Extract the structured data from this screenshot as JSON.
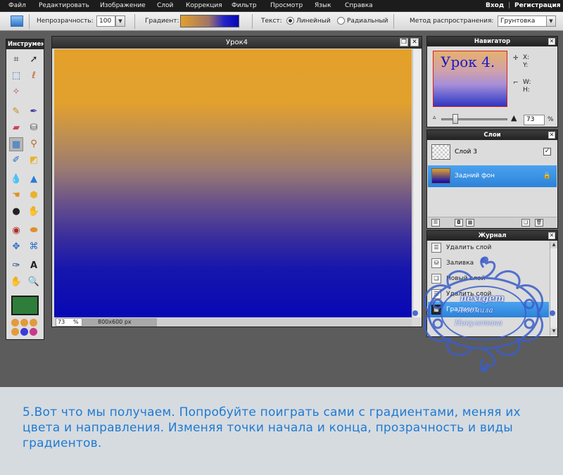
{
  "menubar": {
    "items": [
      "Файл",
      "Редактировать",
      "Изображение",
      "Слой",
      "Коррекция",
      "Фильтр",
      "Просмотр",
      "Язык",
      "Справка"
    ],
    "login": "Вход",
    "register": "Регистрация"
  },
  "options": {
    "opacity_label": "Непрозрачность:",
    "opacity_value": "100",
    "gradient_label": "Градиент:",
    "text_label": "Текст:",
    "radio_linear": "Линейный",
    "radio_radial": "Радиальный",
    "spread_label": "Метод распространения:",
    "spread_value": "Грунтовка"
  },
  "tools": {
    "title": "Инструменты",
    "icons": [
      "crop-icon",
      "move-icon",
      "marquee-icon",
      "lasso-icon",
      "wand-icon",
      "pencil-icon",
      "brush-icon",
      "eraser-icon",
      "bucket-icon",
      "gradient-icon",
      "stamp-icon",
      "replace-color-icon",
      "drawing-icon",
      "blur-icon",
      "sharpen-icon",
      "smudge-icon",
      "sponge-icon",
      "dodge-icon",
      "burn-icon",
      "redeye-icon",
      "spot-heal-icon",
      "bloat-icon",
      "pinch-icon",
      "color-picker-icon",
      "text-icon",
      "hand-icon",
      "zoom-icon"
    ],
    "color_active": "#2f7d3a"
  },
  "document": {
    "title": "Урок4",
    "zoom": "73",
    "zoom_unit": "%",
    "dims": "800x600 px",
    "gradient_top": "#e3a02a",
    "gradient_bottom": "#0808b5"
  },
  "navigator": {
    "title": "Навигатор",
    "thumb_text": "Урок 4.",
    "x_label": "X:",
    "y_label": "Y:",
    "w_label": "W:",
    "h_label": "H:",
    "zoom": "73",
    "zoom_unit": "%"
  },
  "layers": {
    "title": "Слои",
    "items": [
      {
        "name": "Слой 3",
        "selected": false
      },
      {
        "name": "Задний фон",
        "selected": true
      }
    ]
  },
  "history": {
    "title": "Журнал",
    "items": [
      {
        "name": "Удалить слой",
        "selected": false
      },
      {
        "name": "Заливка",
        "selected": false
      },
      {
        "name": "Новый слой",
        "selected": false
      },
      {
        "name": "Удалить слой",
        "selected": false
      },
      {
        "name": "Градиент",
        "selected": true
      }
    ]
  },
  "watermark": {
    "line1": "nextgem",
    "line2": "Людмила",
    "line3": "Никулетина"
  },
  "caption": {
    "text": "5.Вот что мы получаем. Попробуйте поиграть сами с градиентами,  меняя их  цвета и  направления. Изменяя точки начала и конца, прозрачность и виды градиентов."
  }
}
